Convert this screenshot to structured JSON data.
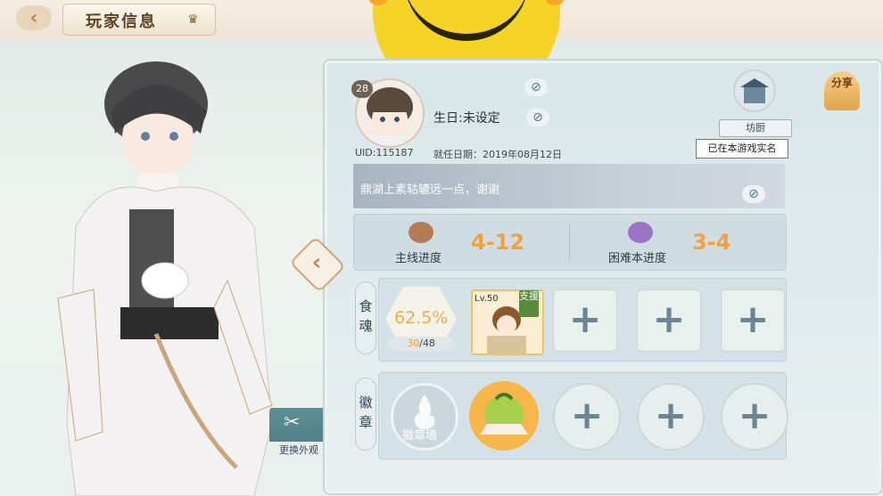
{
  "header": {
    "title": "玩家信息"
  },
  "profile": {
    "level": "28",
    "birthday": "生日:未设定",
    "uid": "UID:115187",
    "join_date": "就任日期：2019年08月12日",
    "signature": "鼎湖上素轱辘远一点，谢谢",
    "restaurant_role": "坊厨",
    "real_name": "已在本游戏实名",
    "share": "分享"
  },
  "progress": {
    "main_label": "主线进度",
    "main_value": "4-12",
    "hard_label": "困难本进度",
    "hard_value": "3-4"
  },
  "souls": {
    "row_label": "食魂",
    "percent": "62.5%",
    "count_current": "30",
    "count_total": "/48",
    "card_level": "Lv.50",
    "card_support": "支援"
  },
  "badges": {
    "row_label": "徽章",
    "wall_label": "徽章墙"
  },
  "side": {
    "change_outfit": "更换外观"
  },
  "colors": {
    "accent": "#f0a040",
    "gold": "#b9894f"
  }
}
